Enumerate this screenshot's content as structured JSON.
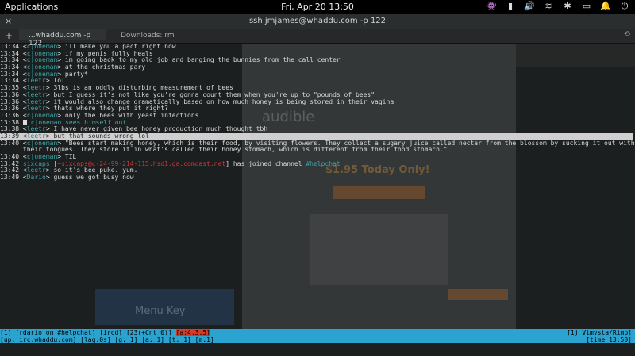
{
  "topbar": {
    "applications": "Applications",
    "clock": "Fri, Apr 20   13:50",
    "tray": [
      "👾",
      "▮",
      "🔊",
      "≋",
      "✱",
      "▭",
      "🔔",
      "⏻"
    ]
  },
  "window": {
    "close": "×",
    "title": "ssh jmjames@whaddu.com -p 122"
  },
  "tabs": {
    "add": "+",
    "active": "...whaddu.com -p 122",
    "other": "Downloads: rm",
    "history": "⟲"
  },
  "background_ghost": {
    "brand": "audible",
    "offer": "$1.95 Today Only!",
    "menu_key": "Menu Key"
  },
  "lines": [
    {
      "ts": "13:34",
      "nick": "c|oneman",
      "msg": "ill make you a pact right now"
    },
    {
      "ts": "13:34",
      "nick": "c|oneman",
      "msg": "if my penis fully heals"
    },
    {
      "ts": "13:34",
      "nick": "c|oneman",
      "msg": "im going back to my old job and banging the bunnies from the call center"
    },
    {
      "ts": "13:34",
      "nick": "c|oneman",
      "msg": "at the christmas pary"
    },
    {
      "ts": "13:34",
      "nick": "c|oneman",
      "msg": "party*"
    },
    {
      "ts": "13:34",
      "nick": "leetr",
      "msg": "lol"
    },
    {
      "ts": "13:35",
      "nick": "leetr",
      "msg": "3lbs is an oddly disturbing measurement of bees"
    },
    {
      "ts": "13:36",
      "nick": "leetr",
      "msg": "but I guess it's not like you're gonna count them when you're up to \"pounds of bees\""
    },
    {
      "ts": "13:36",
      "nick": "leetr",
      "msg": "it would also change dramatically based on how much honey is being stored in their vagina"
    },
    {
      "ts": "13:36",
      "nick": "leetr",
      "msg": "thats where they put it right?"
    },
    {
      "ts": "13:36",
      "nick": "c|oneman",
      "msg": "only the bees with yeast infections"
    },
    {
      "ts": "13:38",
      "action": "c|oneman sees himself out"
    },
    {
      "ts": "13:38",
      "nick": "leetr",
      "msg": "I have never given bee honey production much thought tbh"
    },
    {
      "ts": "13:39",
      "nick": "leetr",
      "msg": "but that sounds wrong lol",
      "highlight": true
    },
    {
      "ts": "13:40",
      "nick": "c|oneman",
      "msg": "\"Bees start making honey, which is their food, by visiting flowers. They collect a sugary juice called nectar from the blossom by sucking it out with"
    },
    {
      "ts": "",
      "nick": "",
      "msg": "their tongues. They store it in what's called their honey stomach, which is different from their food stomach.\"",
      "cont": true
    },
    {
      "ts": "13:40",
      "nick": "c|oneman",
      "msg": "TIL"
    },
    {
      "ts": "13:42",
      "join": true,
      "jnick": "sixcaps",
      "jhost": "~sixcaps@c-24-99-214-115.hsd1.ga.comcast.net",
      "jtext": " has joined channel ",
      "jchan": "#helpchat"
    },
    {
      "ts": "13:42",
      "nick": "leetr",
      "msg": "so it's bee puke. yum."
    },
    {
      "ts": "13:49",
      "nick": "Dario",
      "msg": "guess we got busy now"
    }
  ],
  "status1": {
    "left": "[1] [rdario on #helpchat] [ircd] [23(+Cnt 0)] ",
    "act": "[a:4,3,5]",
    "right": "[1j Vimvsta/Rimp]"
  },
  "status2": {
    "left": "[up: irc.whaddu.com] [lag:0s] [g: 1] [a: 1] [t: 1] [m:1]",
    "right": "[time 13:50]"
  },
  "colors": {
    "statusbar": "#2aa3d0",
    "nick": "#3aa6a8",
    "host": "#d33333"
  }
}
